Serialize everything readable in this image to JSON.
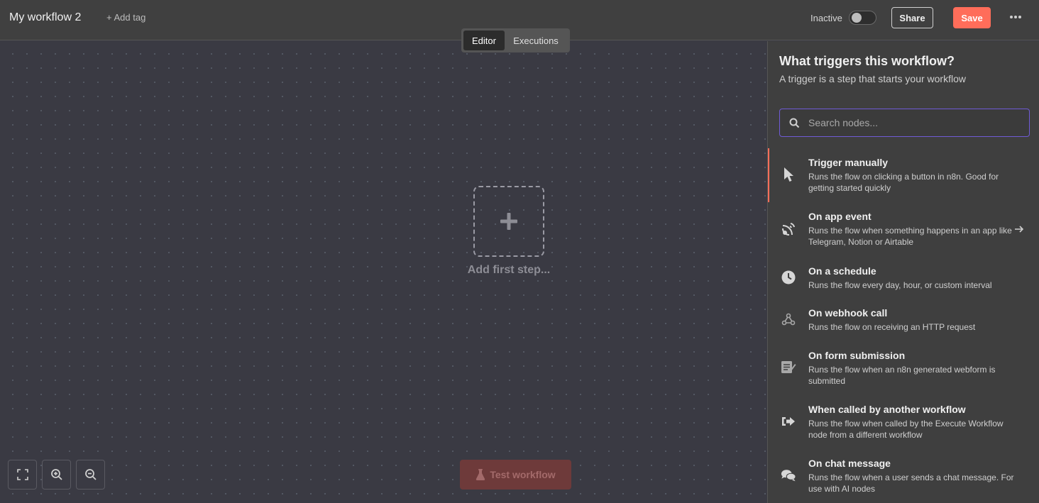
{
  "header": {
    "workflow_name": "My workflow 2",
    "add_tag": "+ Add tag",
    "status_label": "Inactive",
    "share_label": "Share",
    "save_label": "Save",
    "colors": {
      "save": "#ff6d5a"
    }
  },
  "tabs": [
    {
      "label": "Editor",
      "active": true
    },
    {
      "label": "Executions",
      "active": false
    }
  ],
  "canvas": {
    "add_first_step": "Add first step...",
    "test_workflow": "Test workflow"
  },
  "panel": {
    "title": "What triggers this workflow?",
    "subtitle": "A trigger is a step that starts your workflow",
    "search_placeholder": "Search nodes...",
    "triggers": [
      {
        "name": "Trigger manually",
        "desc": "Runs the flow on clicking a button in n8n. Good for getting started quickly",
        "icon": "cursor-icon",
        "selected": true
      },
      {
        "name": "On app event",
        "desc": "Runs the flow when something happens in an app like Telegram, Notion or Airtable",
        "icon": "satellite-dish-icon",
        "has_arrow": true
      },
      {
        "name": "On a schedule",
        "desc": "Runs the flow every day, hour, or custom interval",
        "icon": "clock-icon"
      },
      {
        "name": "On webhook call",
        "desc": "Runs the flow on receiving an HTTP request",
        "icon": "webhook-icon"
      },
      {
        "name": "On form submission",
        "desc": "Runs the flow when an n8n generated webform is submitted",
        "icon": "form-icon"
      },
      {
        "name": "When called by another workflow",
        "desc": "Runs the flow when called by the Execute Workflow node from a different workflow",
        "icon": "sign-in-icon"
      },
      {
        "name": "On chat message",
        "desc": "Runs the flow when a user sends a chat message. For use with AI nodes",
        "icon": "chat-bubbles-icon"
      }
    ]
  }
}
